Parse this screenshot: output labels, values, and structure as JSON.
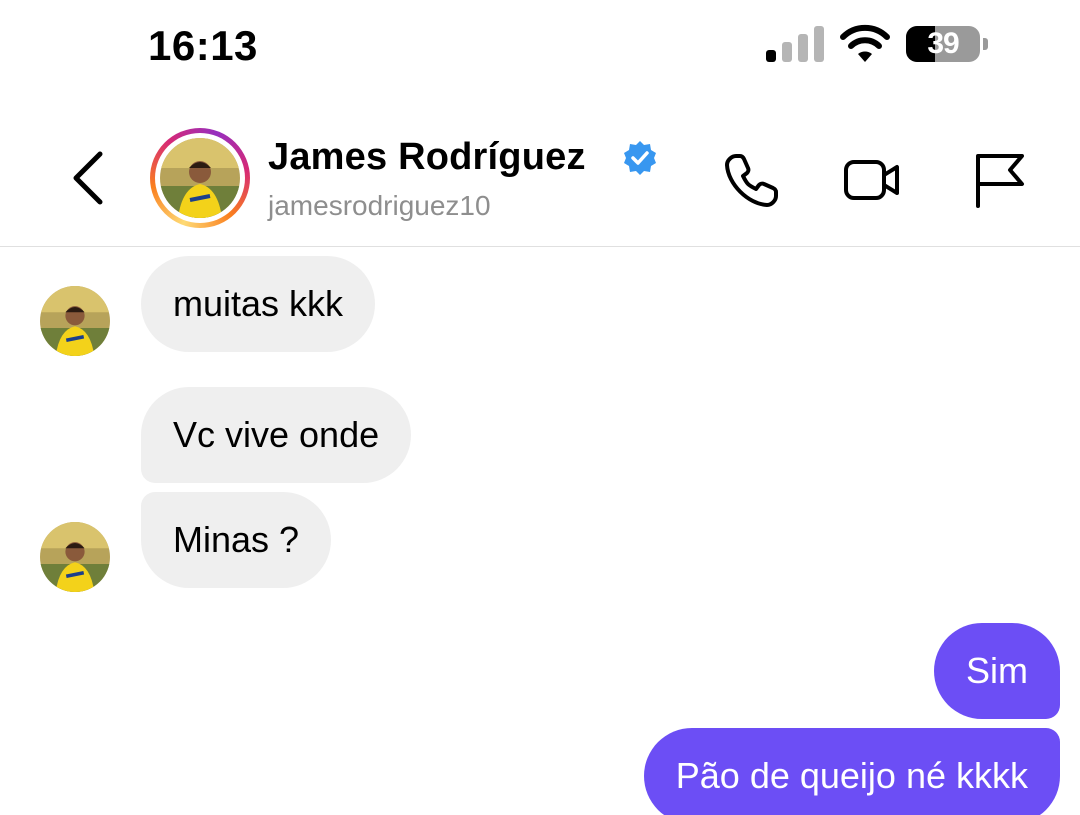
{
  "status_bar": {
    "time": "16:13",
    "battery_level": "39",
    "battery_fraction": 0.39,
    "signal_bars_active": 1,
    "signal_bars_total": 4
  },
  "header": {
    "name": "James Rodríguez",
    "username": "jamesrodriguez10",
    "verified": true,
    "icons": [
      "back-chevron",
      "phone",
      "video-camera",
      "flag"
    ]
  },
  "messages": [
    {
      "sender": "them",
      "text": "muitas kkk",
      "show_avatar": true
    },
    {
      "sender": "them",
      "text": "Vc vive onde",
      "show_avatar": false
    },
    {
      "sender": "them",
      "text": "Minas ?",
      "show_avatar": true
    },
    {
      "sender": "me",
      "text": "Sim"
    },
    {
      "sender": "me",
      "text": "Pão de queijo né kkkk"
    }
  ],
  "colors": {
    "incoming_bubble": "#efefef",
    "outgoing_bubble": "#6c4ef5",
    "verified_badge": "#3897f0",
    "username_gray": "#8e8e8e"
  }
}
